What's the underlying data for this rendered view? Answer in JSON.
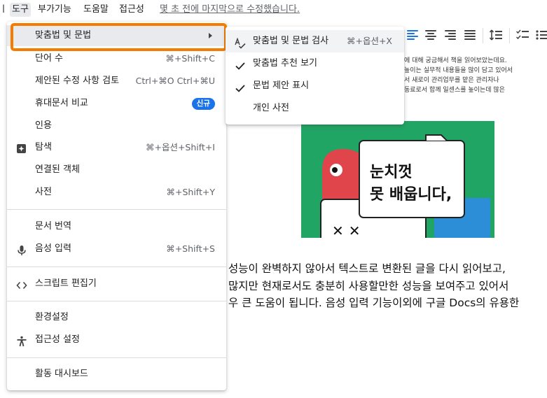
{
  "menubar": {
    "items": [
      "도구",
      "부가기능",
      "도움말",
      "접근성"
    ],
    "active": "도구",
    "last_edit": "몇 초 전에 마지막으로 수정했습니다."
  },
  "tools_menu": {
    "items": [
      {
        "label": "맞춤법 및 문법",
        "submenu": true,
        "highlighted": true
      },
      {
        "label": "단어 수",
        "shortcut": "⌘+Shift+C"
      },
      {
        "label": "제안된 수정 사항 검토",
        "shortcut": "Ctrl+⌘O Ctrl+⌘U"
      },
      {
        "label": "휴대문서 비교",
        "badge": "신규"
      },
      {
        "label": "인용"
      },
      {
        "label": "탐색",
        "shortcut": "⌘+옵션+Shift+I",
        "icon": "explore-plus-icon"
      },
      {
        "label": "연결된 객체"
      },
      {
        "label": "사전",
        "shortcut": "⌘+Shift+Y"
      },
      {
        "label": "문서 번역"
      },
      {
        "label": "음성 입력",
        "shortcut": "⌘+Shift+S",
        "icon": "microphone-icon"
      },
      {
        "label": "스크립트 편집기",
        "icon": "code-icon"
      },
      {
        "label": "환경설정"
      },
      {
        "label": "접근성 설정",
        "icon": "accessibility-icon"
      },
      {
        "label": "활동 대시보드"
      }
    ]
  },
  "spelling_submenu": {
    "items": [
      {
        "label": "맞춤법 및 문법 검사",
        "shortcut": "⌘+옵션+X",
        "icon": "spellcheck-icon"
      },
      {
        "label": "맞춤법 추천 보기",
        "checked": true
      },
      {
        "label": "문법 제안 표시",
        "checked": true
      },
      {
        "label": "개인 사전"
      }
    ]
  },
  "document": {
    "small_lines": [
      "에 대해 궁금해서 책을 읽어보았는데요.",
      "높이는 실무적 내용들을 많이 담고 있어서",
      "서 새로이 관리업무를 맡은 관리자나",
      "동료로서 함께 일센스를 높이는데 많은"
    ],
    "image_text_line1": "눈치껏",
    "image_text_line2": "못 배웁니다,",
    "paragraph": [
      " 성능이 완벽하지 않아서 텍스트로 변환된 글을 다시 읽어보고,",
      "많지만 현재로서도 충분히 사용할만한 성능을 보여주고 있어서 ",
      "우 큰 도움이 됩니다. 음성 입력 기능이외에 구글 Docs의 유용한"
    ]
  },
  "colors": {
    "highlight_box": "#f57c00",
    "accent_blue": "#1a73e8",
    "image_green": "#21a564"
  }
}
